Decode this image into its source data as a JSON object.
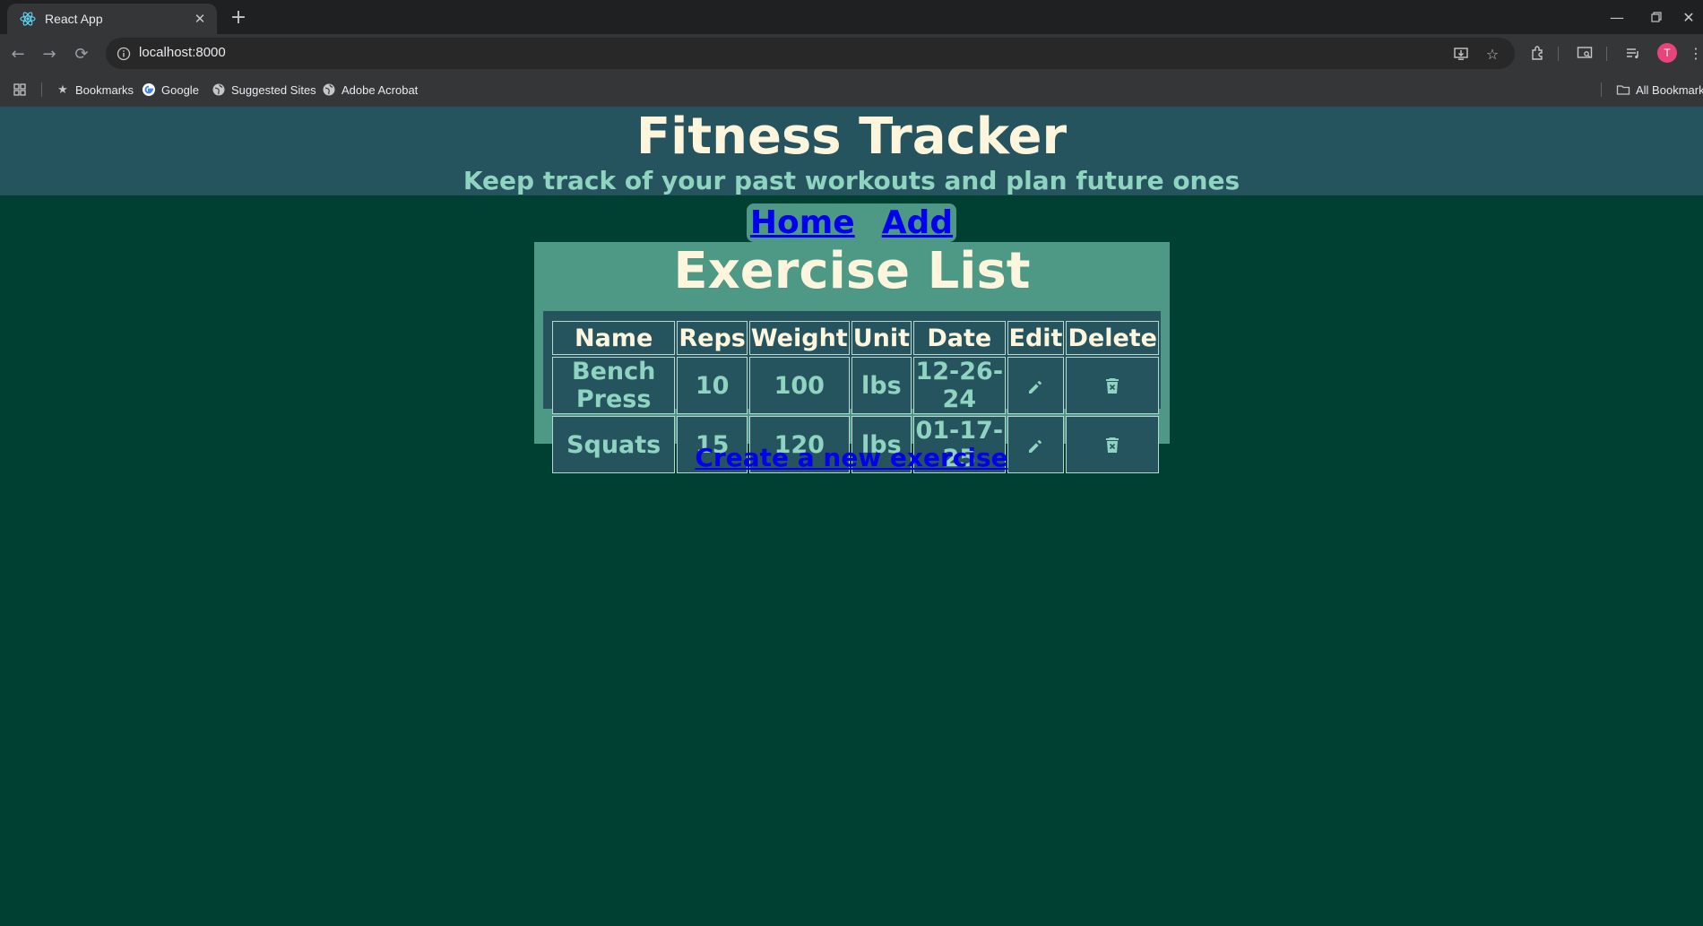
{
  "browser": {
    "tab_title": "React App",
    "new_tab_label": "+",
    "url": "localhost:8000",
    "avatar_initial": "T",
    "bookmarks": [
      "Bookmarks",
      "Google",
      "Suggested Sites",
      "Adobe Acrobat"
    ],
    "all_bookmarks": "All Bookmarks"
  },
  "header": {
    "title": "Fitness Tracker",
    "subtitle": "Keep track of your past workouts and plan future ones"
  },
  "nav": {
    "home": "Home",
    "add": "Add"
  },
  "exercise_list": {
    "title": "Exercise List",
    "columns": [
      "Name",
      "Reps",
      "Weight",
      "Unit",
      "Date",
      "Edit",
      "Delete"
    ],
    "rows": [
      {
        "name": "Bench Press",
        "reps": "10",
        "weight": "100",
        "unit": "lbs",
        "date": "12-26-24"
      },
      {
        "name": "Squats",
        "reps": "15",
        "weight": "120",
        "unit": "lbs",
        "date": "01-17-25"
      }
    ]
  },
  "create_link": "Create a new exercise",
  "colors": {
    "page_bg": "#004033",
    "header_bg": "#26545e",
    "panel_bg": "#4e9886",
    "title_text": "#fdf6dd",
    "cell_text": "#8fd4c0",
    "link": "#0000ee"
  },
  "icons": {
    "edit": "pencil-icon",
    "delete": "trash-icon"
  }
}
